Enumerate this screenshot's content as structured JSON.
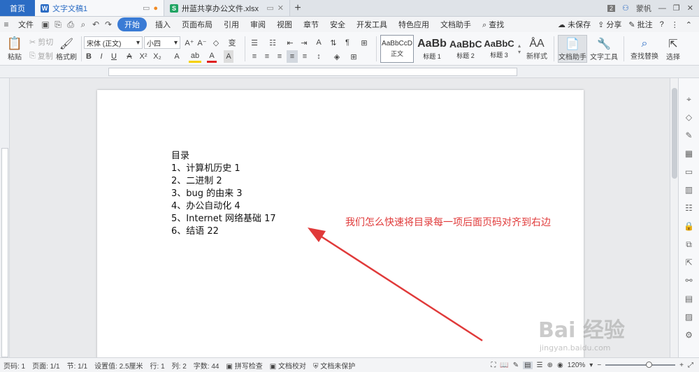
{
  "tabs": {
    "home": "首页",
    "doc1": "文字文稿1",
    "doc2": "卅蓝共享办公文件.xlsx",
    "badge": "2",
    "user": "蒙帆"
  },
  "menu": {
    "file": "文件",
    "items": [
      "开始",
      "插入",
      "页面布局",
      "引用",
      "审阅",
      "视图",
      "章节",
      "安全",
      "开发工具",
      "特色应用",
      "文档助手"
    ],
    "search": "查找",
    "unsaved": "未保存",
    "share": "分享",
    "comment": "批注"
  },
  "ribbon": {
    "paste": "粘贴",
    "cut": "剪切",
    "copy": "复制",
    "format_painter": "格式刷",
    "font_name": "宋体 (正文)",
    "font_size": "小四",
    "styles": [
      {
        "sample": "AaBbCcD",
        "label": "正文"
      },
      {
        "sample": "AaBb",
        "label": "标题 1"
      },
      {
        "sample": "AaBbC",
        "label": "标题 2"
      },
      {
        "sample": "AaBbC",
        "label": "标题 3"
      }
    ],
    "new_style": "新样式",
    "doc_assistant": "文档助手",
    "text_tools": "文字工具",
    "find_replace": "查找替换",
    "select": "选择"
  },
  "document": {
    "toc_title": "目录",
    "toc_items": [
      "1、计算机历史 1",
      "2、二进制 2",
      "3、bug 的由来 3",
      "4、办公自动化 4",
      "5、Internet 网络基础 17",
      "6、结语 22"
    ],
    "annotation": "我们怎么快速将目录每一项后面页码对齐到右边"
  },
  "status": {
    "page_num": "页码: 1",
    "pages": "页面: 1/1",
    "section": "节: 1/1",
    "setting": "设置值: 2.5厘米",
    "row": "行: 1",
    "col": "列: 2",
    "words": "字数: 44",
    "spellcheck": "拼写检查",
    "proofread": "文档校对",
    "protect": "文档未保护",
    "zoom": "120%"
  },
  "watermark": {
    "main": "Bai 经验",
    "sub": "jingyan.baidu.com"
  },
  "colors": {
    "accent": "#3a7bd5",
    "annotation": "#e03a3a"
  }
}
